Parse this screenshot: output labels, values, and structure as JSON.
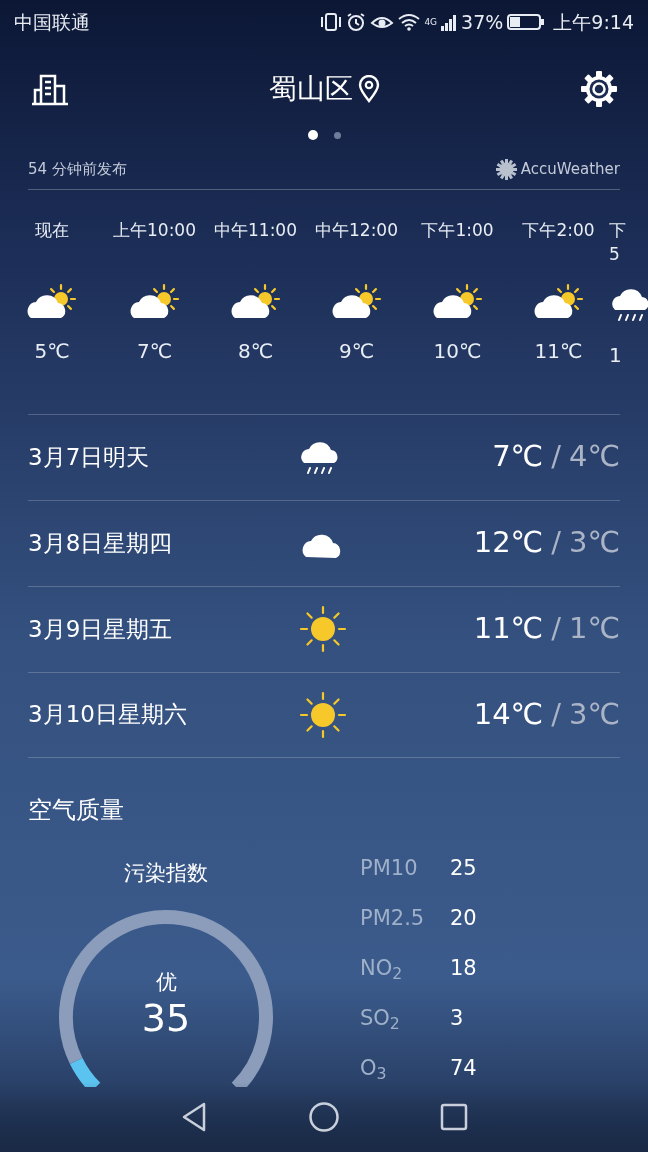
{
  "status_bar": {
    "carrier": "中国联通",
    "network": "4G",
    "battery_text": "37%",
    "time": "上午9:14"
  },
  "header": {
    "city": "蜀山区",
    "pages": [
      {
        "selected": true
      },
      {
        "selected": false
      }
    ]
  },
  "published": "54 分钟前发布",
  "provider": "AccuWeather",
  "hourly": [
    {
      "time": "现在",
      "kind": "partly",
      "temp": "5℃"
    },
    {
      "time": "上午10:00",
      "kind": "partly",
      "temp": "7℃"
    },
    {
      "time": "中午11:00",
      "kind": "partly",
      "temp": "8℃"
    },
    {
      "time": "中午12:00",
      "kind": "partly",
      "temp": "9℃"
    },
    {
      "time": "下午1:00",
      "kind": "partly",
      "temp": "10℃"
    },
    {
      "time": "下午2:00",
      "kind": "partly",
      "temp": "11℃"
    },
    {
      "time": "下",
      "precip": "5",
      "kind": "rain",
      "temp": "1"
    }
  ],
  "daily": [
    {
      "date": "3月7日明天",
      "kind": "rain",
      "high": "7℃",
      "separator": "/",
      "low": "4℃"
    },
    {
      "date": "3月8日星期四",
      "kind": "cloudy",
      "high": "12℃",
      "separator": "/",
      "low": "3℃"
    },
    {
      "date": "3月9日星期五",
      "kind": "sunny",
      "high": "11℃",
      "separator": "/",
      "low": "1℃"
    },
    {
      "date": "3月10日星期六",
      "kind": "sunny",
      "high": "14℃",
      "separator": "/",
      "low": "3℃"
    }
  ],
  "air_quality": {
    "title": "空气质量",
    "gauge_title": "污染指数",
    "grade": "优",
    "index": "35",
    "pollutants": [
      {
        "name": "PM10",
        "value": "25"
      },
      {
        "name": "PM2.5",
        "value": "20"
      },
      {
        "name": "NO$_{2}$",
        "value": "18"
      },
      {
        "name": "SO$_{2}$",
        "value": "3"
      },
      {
        "name": "O$_{3}$",
        "value": "74"
      }
    ]
  }
}
